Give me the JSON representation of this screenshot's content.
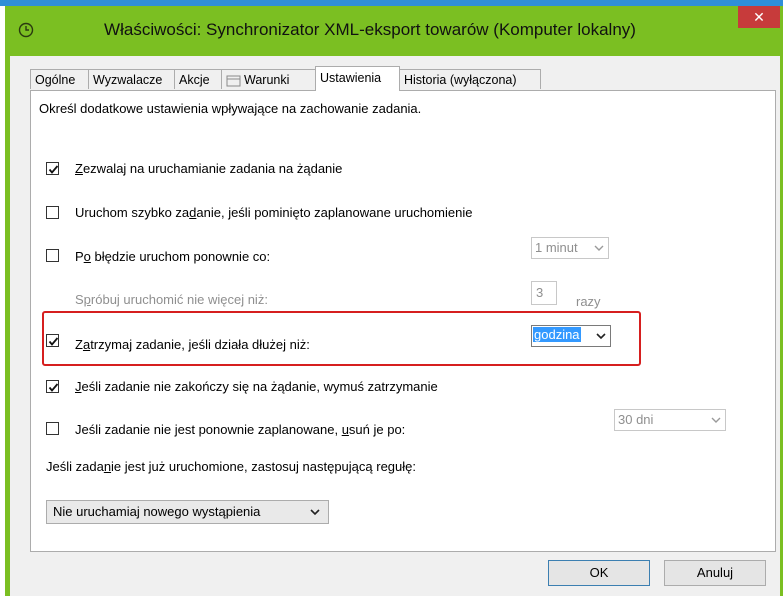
{
  "window": {
    "title": "Właściwości: Synchronizator XML-eksport towarów (Komputer lokalny)",
    "close_glyph": "✕"
  },
  "tabs": [
    {
      "label": "Ogólne"
    },
    {
      "label": "Wyzwalacze"
    },
    {
      "label": "Akcje"
    },
    {
      "label": "Warunki"
    },
    {
      "label": "Ustawienia",
      "active": true
    },
    {
      "label": "Historia (wyłączona)"
    }
  ],
  "settings": {
    "intro": "Określ dodatkowe ustawienia wpływające na zachowanie zadania.",
    "allow_on_demand": {
      "checked": true,
      "accel": "Z",
      "rest": "ezwalaj na uruchamianie zadania na żądanie"
    },
    "run_asap": {
      "checked": false,
      "pre": "Uruchom szybko za",
      "accel": "d",
      "post": "anie, jeśli pominięto zaplanowane uruchomienie"
    },
    "restart_on_fail": {
      "checked": false,
      "pre": "P",
      "accel": "o",
      "post": " błędzie uruchom ponownie co:",
      "interval_value": "1 minut"
    },
    "restart_attempts": {
      "pre": "S",
      "accel": "p",
      "post": "róbuj uruchomić nie więcej niż:",
      "count": "3",
      "unit": "razy"
    },
    "stop_if_longer": {
      "checked": true,
      "pre": "Z",
      "accel": "a",
      "post": "trzymaj zadanie, jeśli działa dłużej niż:",
      "duration_value": "godzina"
    },
    "force_stop": {
      "checked": true,
      "accel": "J",
      "rest": "eśli zadanie nie zakończy się na żądanie, wymuś zatrzymanie"
    },
    "delete_after": {
      "checked": false,
      "pre": "Jeśli zadanie nie jest ponownie zaplanowane, ",
      "accel": "u",
      "post": "suń je po:",
      "delay_value": "30 dni"
    },
    "rule_label": {
      "pre": "Jeśli zada",
      "accel": "n",
      "post": "ie jest już uruchomione, zastosuj następującą regułę:"
    },
    "rule_value": "Nie uruchamiaj nowego wystąpienia"
  },
  "buttons": {
    "ok": "OK",
    "cancel": "Anuluj"
  },
  "colors": {
    "title_bar": "#7bbf22",
    "close_button": "#c73b3b",
    "highlight_frame": "#d61f1f",
    "selection": "#3399ff"
  }
}
